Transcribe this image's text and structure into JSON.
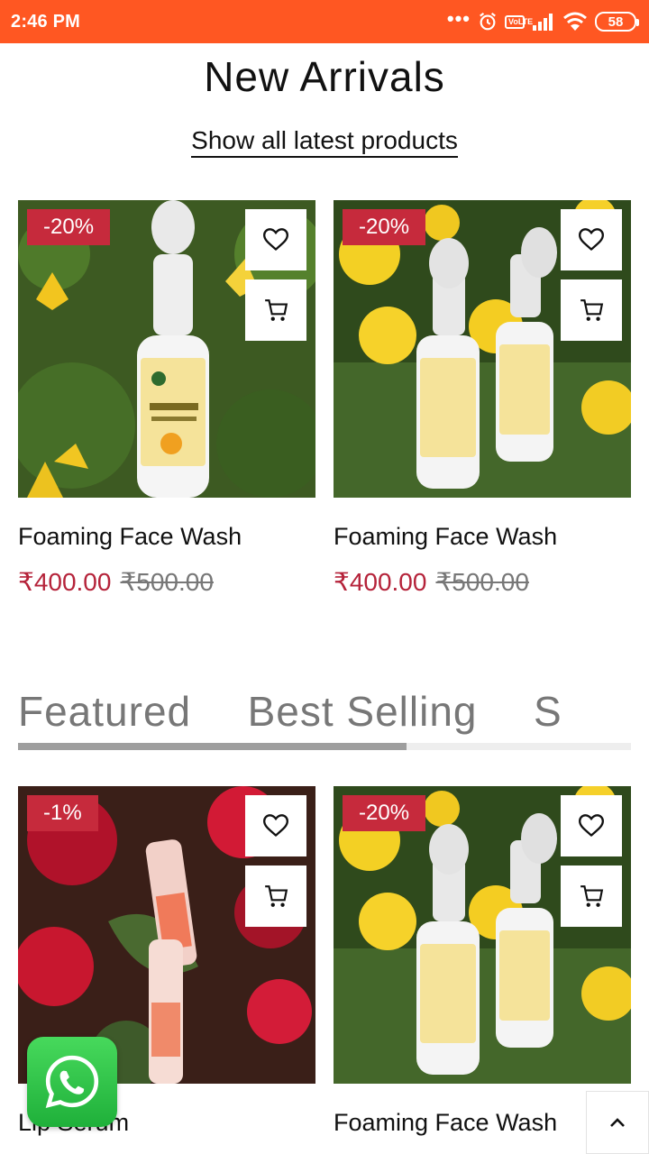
{
  "status_bar": {
    "time": "2:46 PM",
    "network_label": "VoLTE",
    "battery": "58"
  },
  "new_arrivals": {
    "title": "New Arrivals",
    "link": "Show all latest products",
    "products": [
      {
        "discount": "-20%",
        "name": "Foaming Face Wash",
        "price": "₹400.00",
        "old_price": "₹500.00"
      },
      {
        "discount": "-20%",
        "name": "Foaming Face Wash",
        "price": "₹400.00",
        "old_price": "₹500.00"
      }
    ]
  },
  "tabs": {
    "items": [
      "Featured",
      "Best Selling",
      "S"
    ],
    "active_index": 0
  },
  "featured": {
    "products": [
      {
        "discount": "-1%",
        "name": "Lip Serum"
      },
      {
        "discount": "-20%",
        "name": "Foaming Face Wash"
      }
    ]
  },
  "colors": {
    "status_bar": "#ff5722",
    "badge": "#c62a3c",
    "price": "#b5233a",
    "whatsapp": "#25d366"
  },
  "icons": [
    "heart-icon",
    "cart-icon",
    "whatsapp-icon",
    "chevron-up-icon",
    "wifi-icon",
    "alarm-icon",
    "signal-icon"
  ]
}
